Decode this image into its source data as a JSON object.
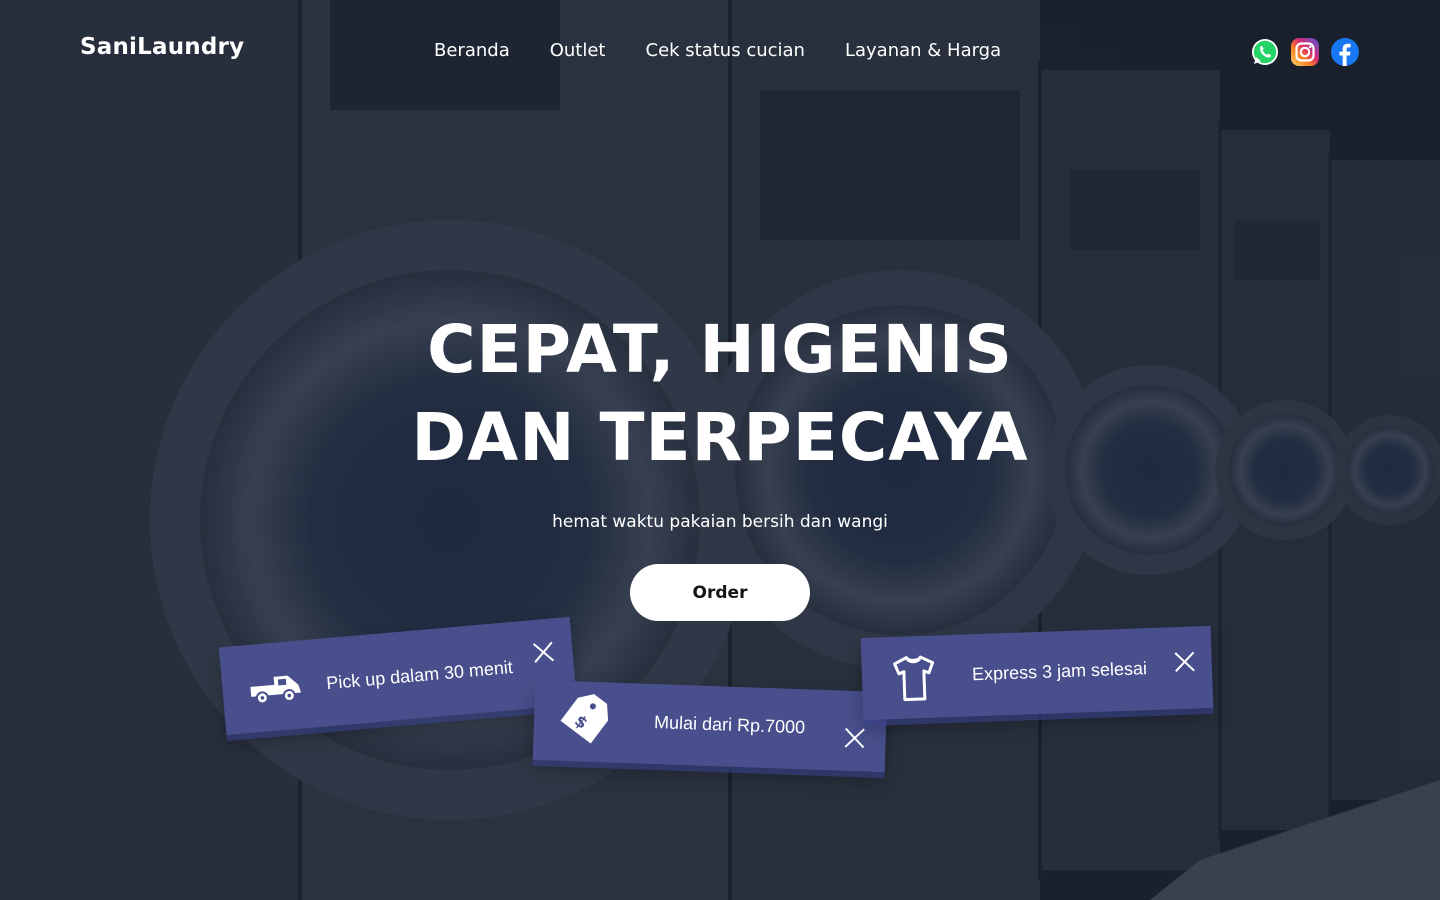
{
  "brand": {
    "name": "SaniLaundry"
  },
  "nav": {
    "items": [
      {
        "label": "Beranda"
      },
      {
        "label": "Outlet"
      },
      {
        "label": "Cek status cucian"
      },
      {
        "label": "Layanan & Harga"
      }
    ]
  },
  "socials": [
    {
      "icon": "whatsapp-icon",
      "color": "#25d366"
    },
    {
      "icon": "instagram-icon",
      "color": "#e1306c"
    },
    {
      "icon": "facebook-icon",
      "color": "#1877f2"
    }
  ],
  "hero": {
    "headline_line1": "CEPAT, HIGENIS",
    "headline_line2": "DAN TERPECAYA",
    "subtitle": "hemat waktu pakaian bersih dan wangi",
    "cta_label": "Order"
  },
  "features": [
    {
      "icon": "truck-icon",
      "label": "Pick up dalam 30 menit"
    },
    {
      "icon": "price-tag-icon",
      "label": "Mulai dari Rp.7000"
    },
    {
      "icon": "shirt-icon",
      "label": "Express 3 jam selesai"
    }
  ],
  "colors": {
    "card_background": "#484f8c",
    "button_background": "#ffffff",
    "text": "#ffffff"
  }
}
